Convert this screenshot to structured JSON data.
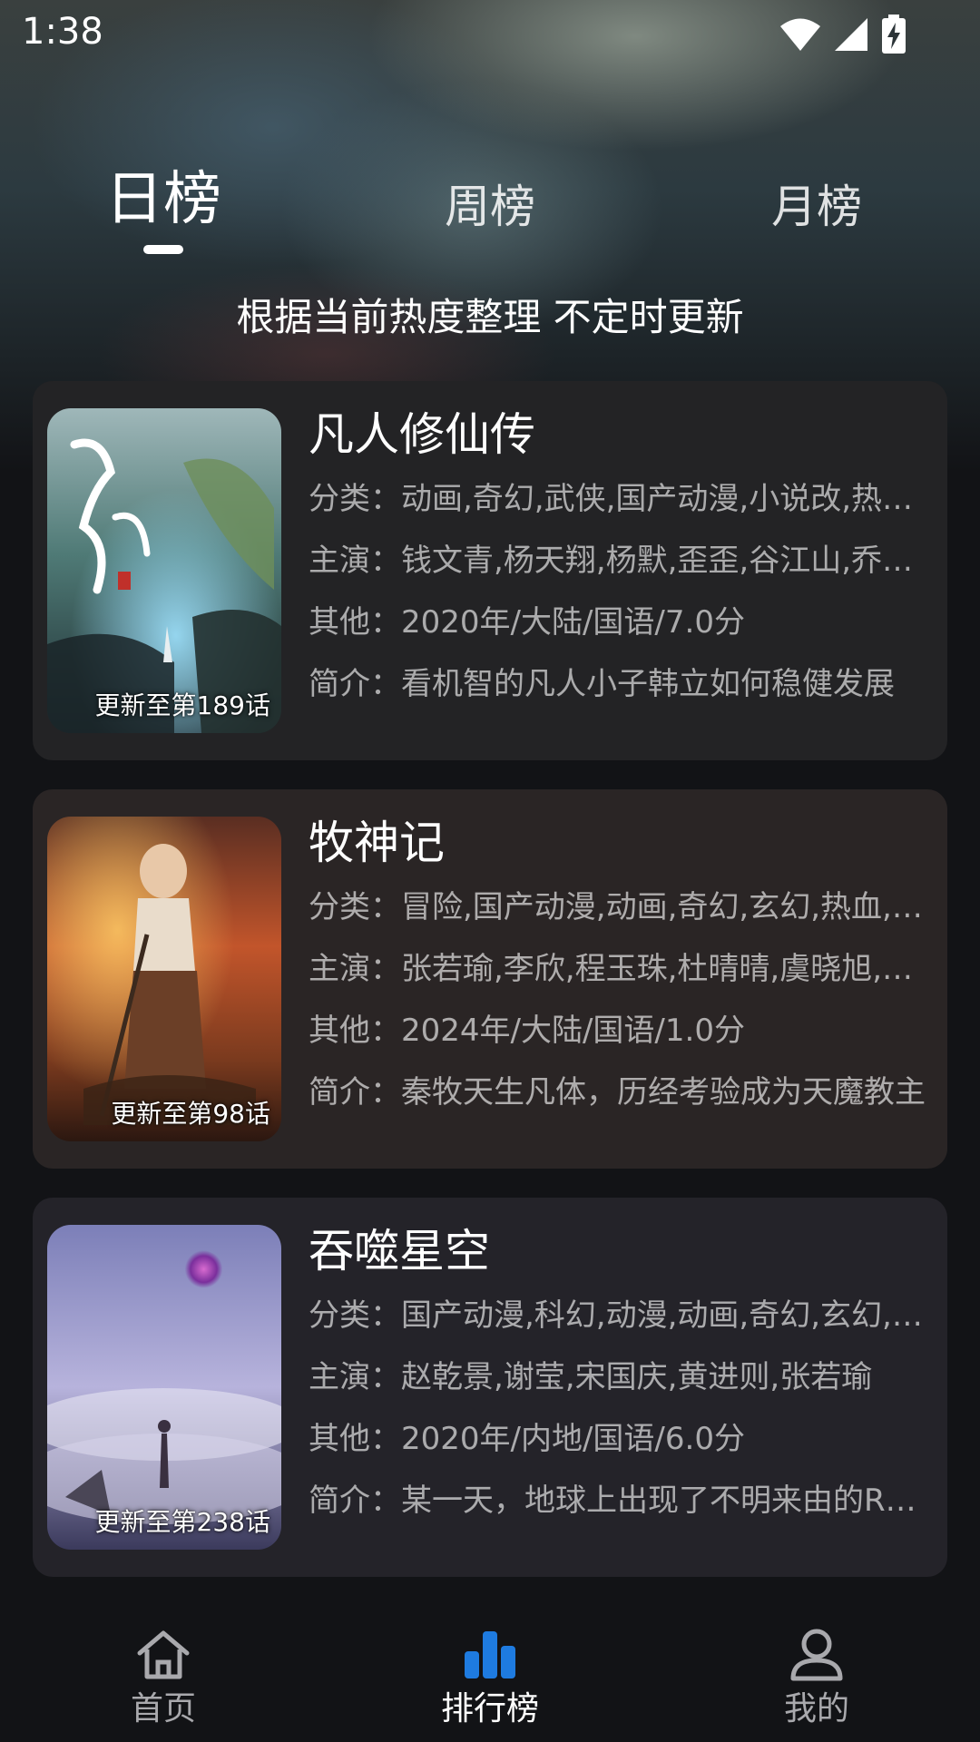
{
  "status_bar": {
    "time": "1:38",
    "icons": [
      "wifi-icon",
      "signal-icon",
      "battery-charging-icon"
    ]
  },
  "tabs": [
    {
      "label": "日榜",
      "active": true
    },
    {
      "label": "周榜",
      "active": false
    },
    {
      "label": "月榜",
      "active": false
    }
  ],
  "subtitle": "根据当前热度整理 不定时更新",
  "cards": [
    {
      "title": "凡人修仙传",
      "badge": "更新至第189话",
      "category": "分类：动画,奇幻,武侠,国产动漫,小说改,热血,古装",
      "cast": "主演：钱文青,杨天翔,杨默,歪歪,谷江山,乔诗语",
      "other": "其他：2020年/大陆/国语/7.0分",
      "intro": "简介：看机智的凡人小子韩立如何稳健发展"
    },
    {
      "title": "牧神记",
      "badge": "更新至第98话",
      "category": "分类：冒险,国产动漫,动画,奇幻,玄幻,热血,小说改",
      "cast": "主演：张若瑜,李欣,程玉珠,杜晴晴,虞晓旭,阎萌萌",
      "other": "其他：2024年/大陆/国语/1.0分",
      "intro": "简介：秦牧天生凡体，历经考验成为天魔教主"
    },
    {
      "title": "吞噬星空",
      "badge": "更新至第238话",
      "category": "分类：国产动漫,科幻,动漫,动画,奇幻,玄幻,热血",
      "cast": "主演：赵乾景,谢莹,宋国庆,黄进则,张若瑜",
      "other": "其他：2020年/内地/国语/6.0分",
      "intro": "简介：某一天，地球上出现了不明来由的R…"
    }
  ],
  "bottom_nav": [
    {
      "label": "首页",
      "icon": "home-icon",
      "active": false
    },
    {
      "label": "排行榜",
      "icon": "bar-chart-icon",
      "active": true
    },
    {
      "label": "我的",
      "icon": "user-icon",
      "active": false
    }
  ],
  "colors": {
    "accent": "#1e7be0",
    "card_bg": "#232325",
    "text_primary": "#ffffff",
    "text_secondary": "#9c9ca0"
  }
}
